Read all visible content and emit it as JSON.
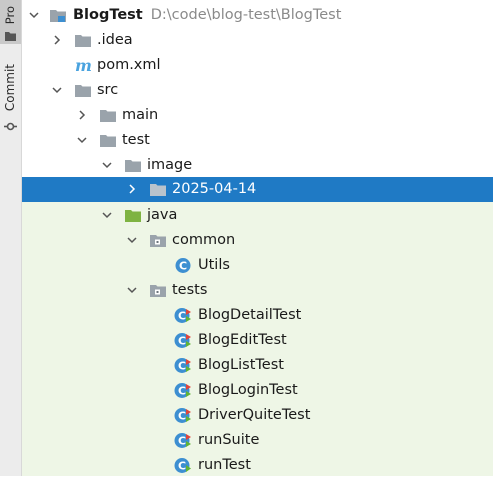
{
  "side_panel": {
    "project_label": "Pro",
    "commit_label": "Commit"
  },
  "tree": {
    "root_name": "BlogTest",
    "root_path": "D:\\code\\blog-test\\BlogTest",
    "idea": ".idea",
    "pom": "pom.xml",
    "src": "src",
    "main": "main",
    "test": "test",
    "image": "image",
    "date_folder": "2025-04-14",
    "java": "java",
    "common": "common",
    "utils": "Utils",
    "tests": "tests",
    "blog_detail_test": "BlogDetailTest",
    "blog_edit_test": "BlogEditTest",
    "blog_list_test": "BlogListTest",
    "blog_login_test": "BlogLoginTest",
    "driver_quite_test": "DriverQuiteTest",
    "run_suite": "runSuite",
    "run_test": "runTest"
  },
  "colors": {
    "selection": "#1f7ac5",
    "test_sources_bg": "#eef6e6",
    "folder_gray": "#9aa3ab",
    "folder_green": "#7eb342",
    "class_blue": "#3d8fd1",
    "maven_blue": "#4aa3df"
  }
}
